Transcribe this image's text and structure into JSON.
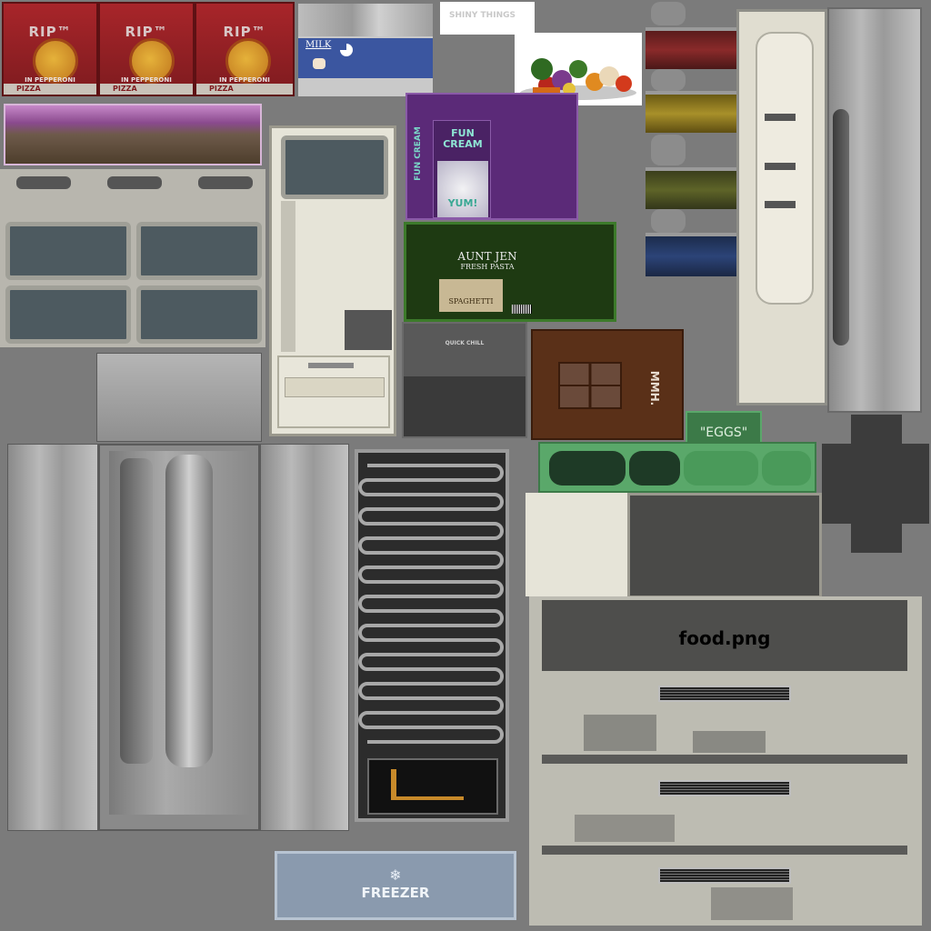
{
  "pizza": {
    "logo": "RIP™",
    "sub": "IN PEPPERONI",
    "foot": "PIZZA"
  },
  "milk": {
    "label": "MILK"
  },
  "shiny_things": "SHINY THINGS",
  "fun_cream": {
    "side": "FUN CREAM",
    "title": "FUN CREAM",
    "yum": "YUM!"
  },
  "pasta": {
    "brand": "AUNT JEN",
    "line": "FRESH PASTA",
    "variety": "SPAGHETTI"
  },
  "quick_chill": "QUICK CHILL",
  "chocolate": "MMH.",
  "eggs": "\"EGGS\"",
  "food_title": "food.png",
  "freezer": {
    "icon": "❄",
    "label": "FREEZER"
  },
  "colors": {
    "pizza_red": "#a8252a",
    "fun_cream_purple": "#5b2a78",
    "pasta_green": "#2f5a1e",
    "egg_green": "#3c8a4a",
    "choc_brown": "#5a3018",
    "freezer_blue": "#8a9aae"
  }
}
